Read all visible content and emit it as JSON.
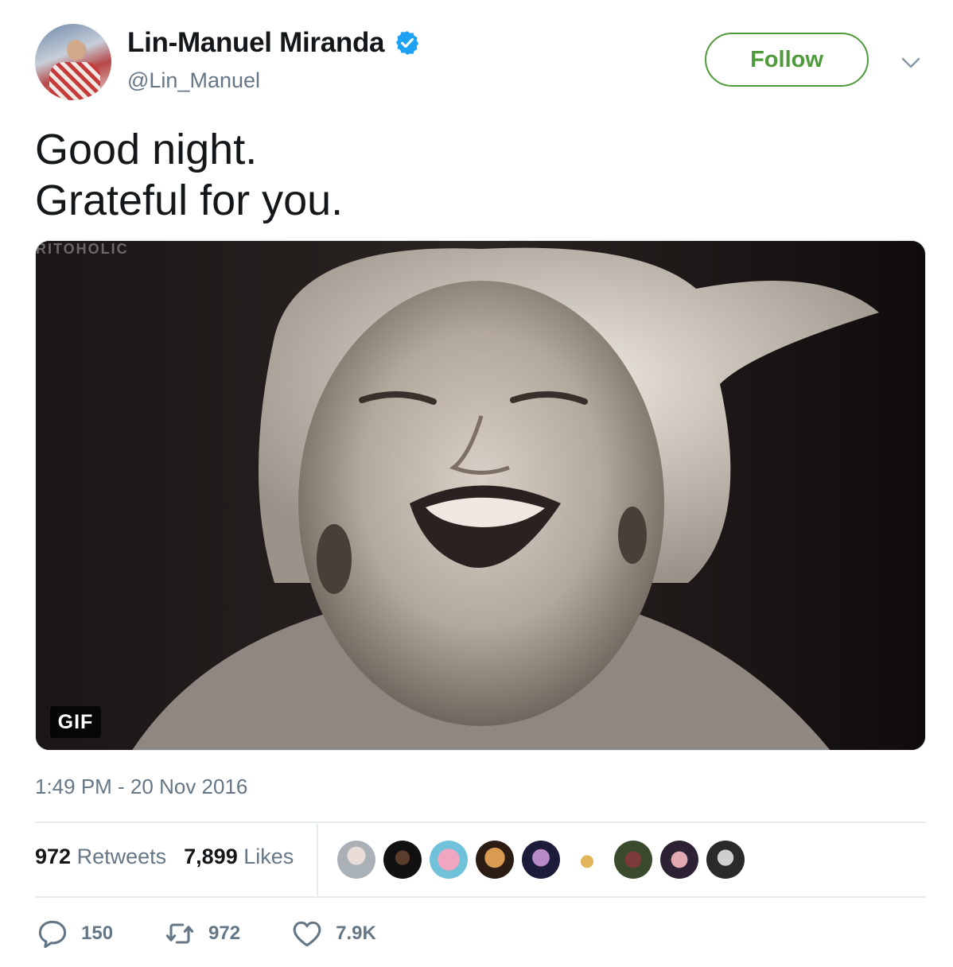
{
  "user": {
    "display_name": "Lin-Manuel Miranda",
    "handle": "@Lin_Manuel",
    "verified": true
  },
  "follow_button": {
    "label": "Follow",
    "color": "#4f9a3a"
  },
  "tweet": {
    "lines": [
      "Good night.",
      "Grateful for you."
    ],
    "media": {
      "badge": "GIF",
      "watermark": "RITOHOLIC"
    },
    "timestamp": "1:49 PM - 20 Nov 2016"
  },
  "stats": {
    "retweets_count": "972",
    "retweets_label": "Retweets",
    "likes_count": "7,899",
    "likes_label": "Likes"
  },
  "actions": {
    "replies": "150",
    "retweets": "972",
    "likes": "7.9K"
  },
  "colors": {
    "verified_blue": "#1da1f2",
    "secondary_text": "#657786"
  }
}
